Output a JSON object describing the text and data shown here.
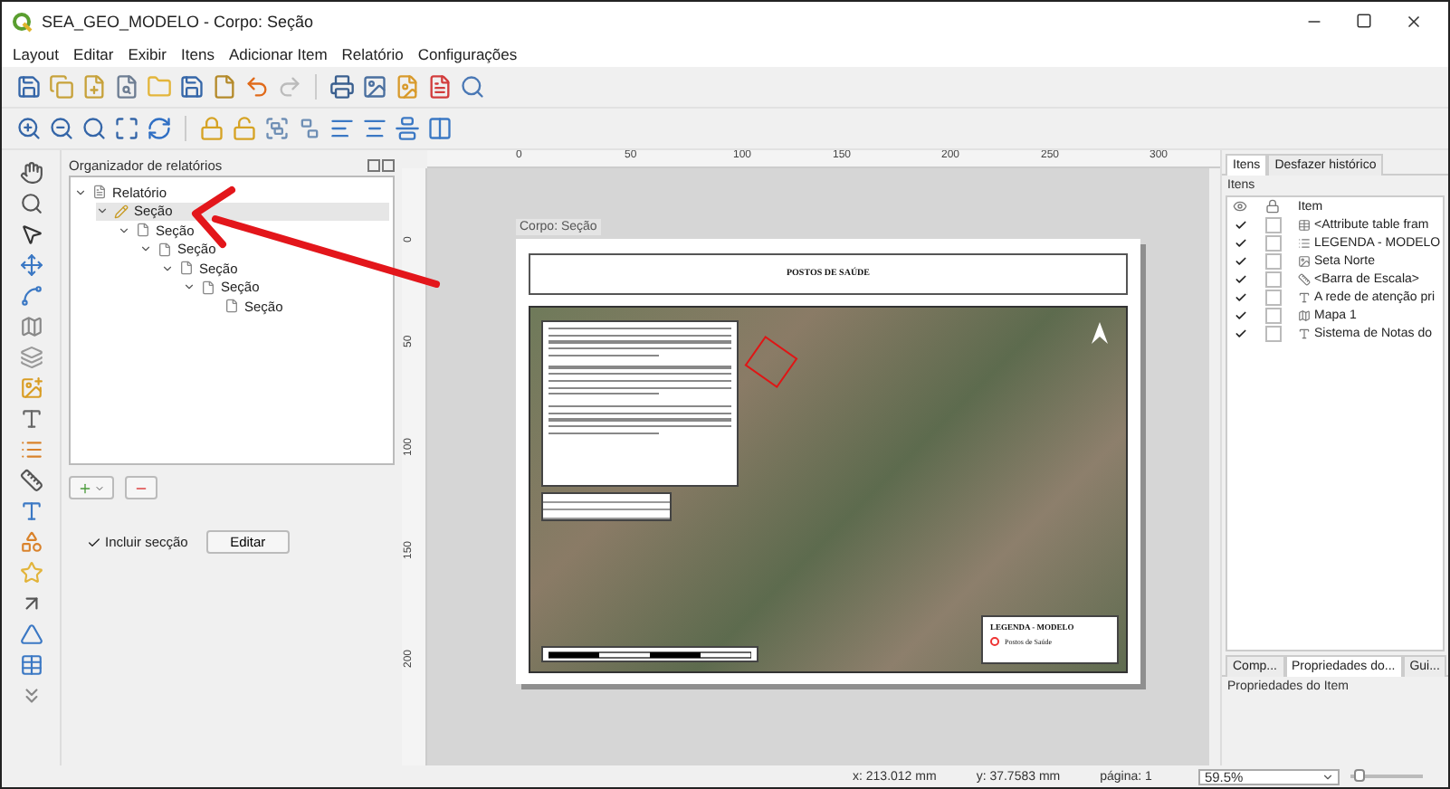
{
  "window": {
    "title": "SEA_GEO_MODELO - Corpo: Seção"
  },
  "menu": [
    "Layout",
    "Editar",
    "Exibir",
    "Itens",
    "Adicionar Item",
    "Relatório",
    "Configurações"
  ],
  "organizer": {
    "title": "Organizador de relatórios",
    "tree": [
      {
        "label": "Relatório",
        "kind": "report",
        "selected": false,
        "expanded": true,
        "children": [
          {
            "label": "Seção",
            "kind": "section",
            "selected": true,
            "expanded": true,
            "children": [
              {
                "label": "Seção",
                "kind": "section",
                "selected": false,
                "expanded": true,
                "children": [
                  {
                    "label": "Seção",
                    "kind": "section",
                    "selected": false,
                    "expanded": true,
                    "children": [
                      {
                        "label": "Seção",
                        "kind": "section",
                        "selected": false,
                        "expanded": true,
                        "children": [
                          {
                            "label": "Seção",
                            "kind": "section",
                            "selected": false,
                            "expanded": true,
                            "children": [
                              {
                                "label": "Seção",
                                "kind": "section",
                                "selected": false
                              }
                            ]
                          }
                        ]
                      }
                    ]
                  }
                ]
              }
            ]
          }
        ]
      }
    ],
    "include_section": {
      "label": "Incluir secção",
      "checked": true
    },
    "edit_button": "Editar"
  },
  "canvas": {
    "tab_label": "Corpo: Seção",
    "hruler": [
      "0",
      "50",
      "100",
      "150",
      "200",
      "250",
      "300"
    ],
    "vruler": [
      "0",
      "50",
      "100",
      "150",
      "200"
    ],
    "page": {
      "title": "POSTOS DE SAÚDE",
      "legend": {
        "title": "LEGENDA - MODELO",
        "items": [
          {
            "label": "Postos de Saúde",
            "kind": "point"
          }
        ]
      }
    }
  },
  "right_panel": {
    "tabs": [
      {
        "label": "Itens",
        "selected": true
      },
      {
        "label": "Desfazer histórico",
        "selected": false
      }
    ],
    "items_title": "Itens",
    "column": "Item",
    "items": [
      {
        "name": "<Attribute table fram",
        "kind": "table",
        "visible": true,
        "locked": false
      },
      {
        "name": "LEGENDA - MODELO",
        "kind": "legend",
        "visible": true,
        "locked": false
      },
      {
        "name": "Seta Norte",
        "kind": "picture",
        "visible": true,
        "locked": false
      },
      {
        "name": "<Barra de Escala>",
        "kind": "scalebar",
        "visible": true,
        "locked": false
      },
      {
        "name": "A rede de atenção pri",
        "kind": "label",
        "visible": true,
        "locked": false
      },
      {
        "name": "Mapa 1",
        "kind": "map",
        "visible": true,
        "locked": false
      },
      {
        "name": "Sistema de Notas do",
        "kind": "label",
        "visible": true,
        "locked": false
      }
    ],
    "bottom_tabs": [
      {
        "label": "Comp...",
        "selected": false
      },
      {
        "label": "Propriedades do...",
        "selected": true
      },
      {
        "label": "Gui...",
        "selected": false
      }
    ],
    "properties_title": "Propriedades do Item"
  },
  "status": {
    "x": "x: 213.012 mm",
    "y": "y: 37.7583 mm",
    "page": "página: 1",
    "zoom": "59.5%",
    "zoom_slider": {
      "level": 0.05
    }
  }
}
